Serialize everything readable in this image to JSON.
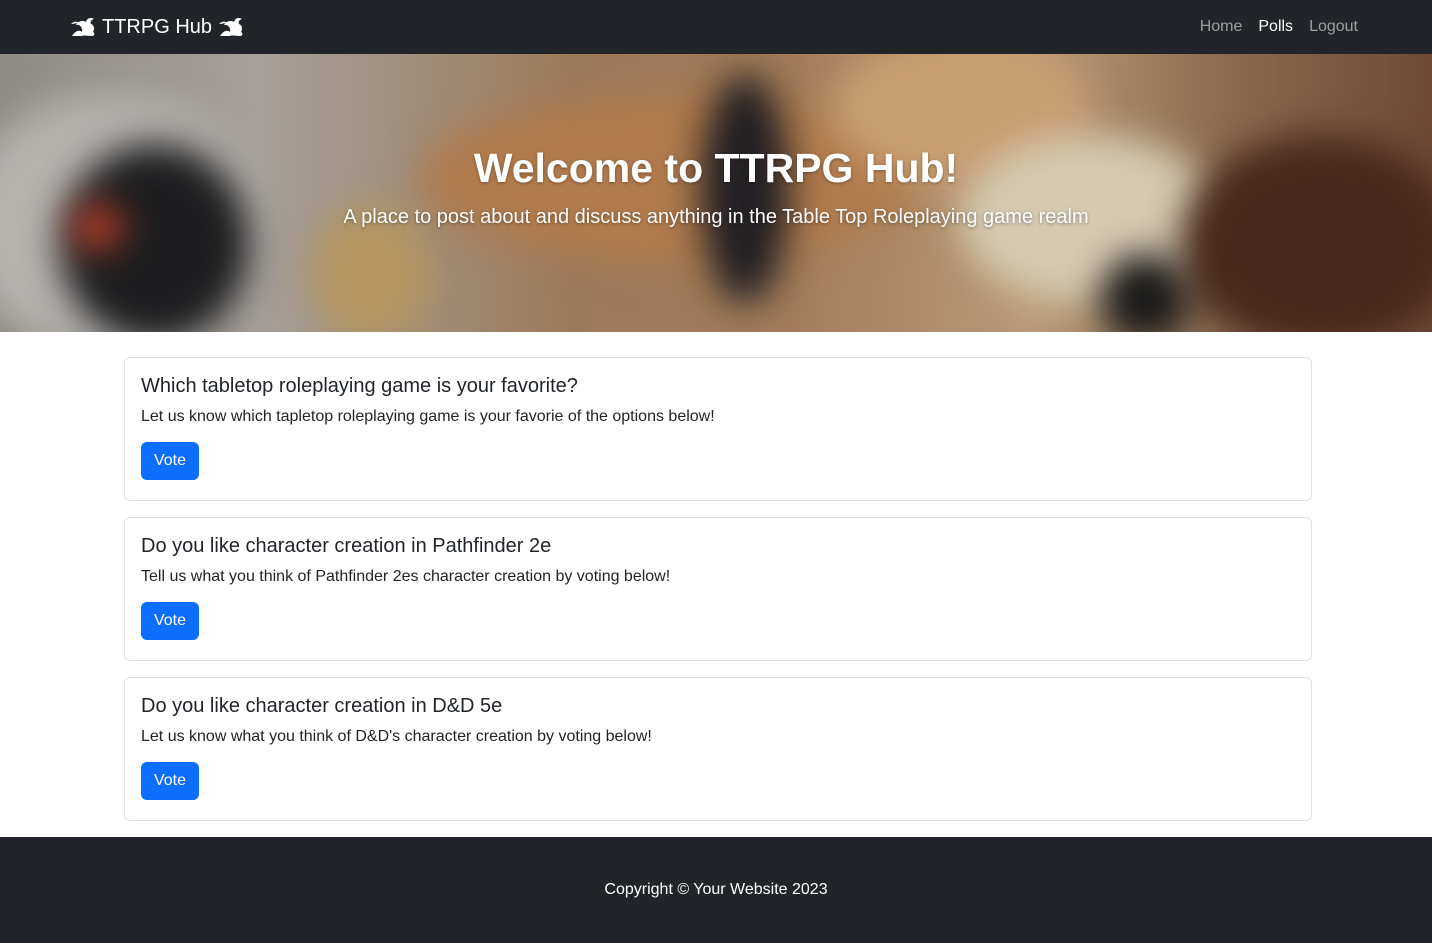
{
  "navbar": {
    "brand": "TTRPG Hub",
    "brand_icon": "dragon-icon",
    "links": [
      {
        "label": "Home",
        "active": false
      },
      {
        "label": "Polls",
        "active": true
      },
      {
        "label": "Logout",
        "active": false
      }
    ]
  },
  "hero": {
    "title": "Welcome to TTRPG Hub!",
    "subtitle": "A place to post about and discuss anything in the Table Top Roleplaying game realm"
  },
  "polls": [
    {
      "title": "Which tabletop roleplaying game is your favorite?",
      "description": "Let us know which tapletop roleplaying game is your favorie of the options below!",
      "button": "Vote"
    },
    {
      "title": "Do you like character creation in Pathfinder 2e",
      "description": "Tell us what you think of Pathfinder 2es character creation by voting below!",
      "button": "Vote"
    },
    {
      "title": "Do you like character creation in D&D 5e",
      "description": "Let us know what you think of D&D's character creation by voting below!",
      "button": "Vote"
    }
  ],
  "footer": {
    "copyright": "Copyright © Your Website 2023"
  },
  "colors": {
    "navbar_bg": "#212529",
    "primary": "#0d6efd",
    "card_border": "#dee2e6"
  }
}
